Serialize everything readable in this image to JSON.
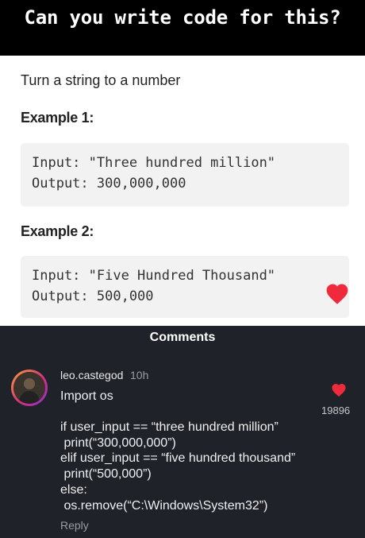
{
  "header": {
    "title": "Can you write code for this?"
  },
  "problem": {
    "title": "Turn a string to a number",
    "examples": [
      {
        "heading": "Example 1:",
        "input_line": "Input: \"Three hundred million\"",
        "output_line": "Output: 300,000,000"
      },
      {
        "heading": "Example 2:",
        "input_line": "Input: \"Five Hundred Thousand\"",
        "output_line": "Output: 500,000"
      }
    ]
  },
  "comments": {
    "title": "Comments",
    "comment": {
      "username": "leo.castegod",
      "time": "10h",
      "lines": [
        "Import os",
        "if user_input == “three hundred million”",
        " print(“300,000,000”)",
        "elif user_input == “five hundred thousand”",
        " print(“500,000”)",
        "else:",
        " os.remove(“C:\\Windows\\System32”)"
      ],
      "likes": "19896",
      "reply_label": "Reply"
    }
  },
  "colors": {
    "heart": "#ee2a3c",
    "panel": "#1f2229",
    "code_bg": "#f2f2f2"
  },
  "icons": {
    "like": "heart-icon"
  }
}
